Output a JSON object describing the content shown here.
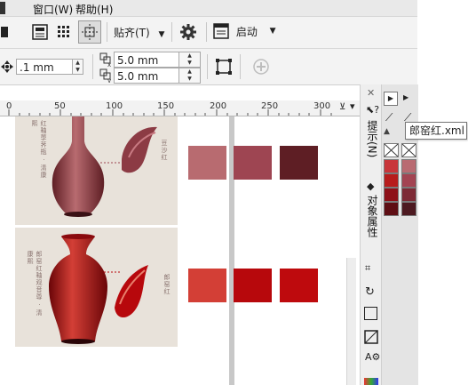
{
  "menubar": {
    "items": [
      "窗口(W)",
      "帮助(H)"
    ]
  },
  "toolbar1": {
    "snap_label": "贴齐(T)",
    "launch_label": "启动"
  },
  "toolbar2": {
    "nudge_value": ".1 mm",
    "dup_x_value": "5.0 mm",
    "dup_y_value": "5.0 mm"
  },
  "ruler": {
    "labels": [
      "0",
      "50",
      "100",
      "150",
      "200",
      "250",
      "300"
    ]
  },
  "artwork": {
    "top_caption_left": "红釉荸荠瓶 · 清康熙",
    "top_caption_right": "豆沙红",
    "bottom_caption_left": "郎窑红釉观音尊 · 清康熙",
    "bottom_caption_right": "郎窑红"
  },
  "colors": {
    "row1": [
      "#b86b70",
      "#9e4552",
      "#5e1e24"
    ],
    "row2": [
      "#d33f36",
      "#b7080c",
      "#be0a0d"
    ],
    "page_bg": "#e8e2da"
  },
  "dockers": {
    "hints_label": "提示(N)",
    "object_props_label": "对象属性"
  },
  "palette": {
    "tooltip": "郎窑红.xml",
    "col1": [
      "#c8353a",
      "#b71c1c",
      "#8e1018",
      "#5e0e14",
      "#3a0b0e"
    ],
    "col2": [
      "#b96b72",
      "#a34452",
      "#7d2a35",
      "#4d1a21",
      "#2a1214"
    ]
  }
}
